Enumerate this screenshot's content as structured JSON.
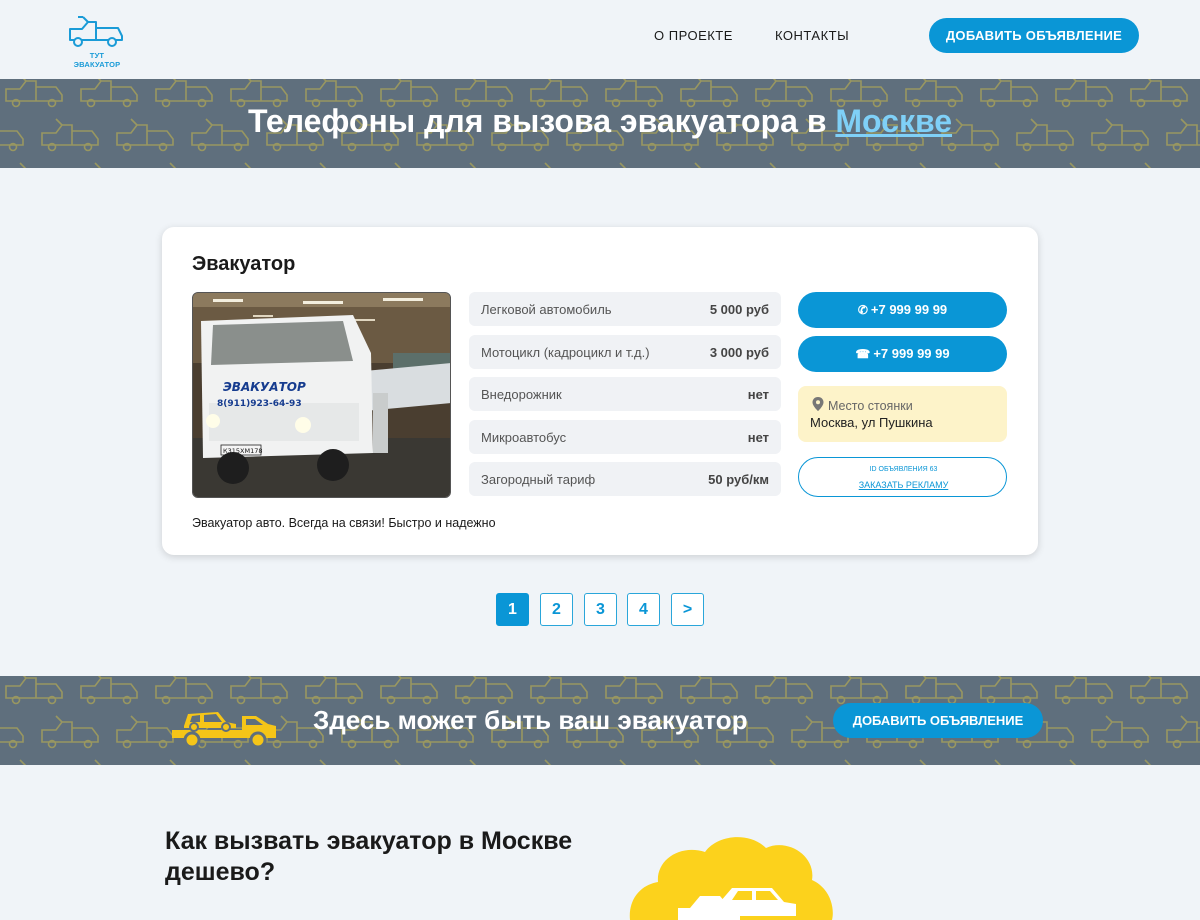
{
  "header": {
    "logo_text": "ТУТ ЭВАКУАТОР",
    "nav": [
      "О ПРОЕКТЕ",
      "КОНТАКТЫ"
    ],
    "add_button": "ДОБАВИТЬ ОБЪЯВЛЕНИЕ"
  },
  "hero": {
    "title_prefix": "Телефоны для вызова эвакуатора в ",
    "city": "Москве"
  },
  "listing": {
    "title": "Эвакуатор",
    "photo_text": "ЭВАКУАТОР",
    "photo_phone": "8(911)923-64-93",
    "photo_plate": "К315ХМ178",
    "prices": [
      {
        "label": "Легковой автомобиль",
        "value": "5 000 руб"
      },
      {
        "label": "Мотоцикл (кадроцикл и т.д.)",
        "value": "3 000 руб"
      },
      {
        "label": "Внедорожник",
        "value": "нет"
      },
      {
        "label": "Микроавтобус",
        "value": "нет"
      },
      {
        "label": "Загородный тариф",
        "value": "50 руб/км"
      }
    ],
    "phones": [
      "+7 999 99 99",
      "+7 999 99 99"
    ],
    "parking_label": "Место стоянки",
    "parking_address": "Москва, ул Пушкина",
    "ad_id": "ID ОБЪЯВЛЕНИЯ 63",
    "ad_link": "ЗАКАЗАТЬ РЕКЛАМУ",
    "description": "Эвакуатор авто. Всегда на связи! Быстро и надежно"
  },
  "pagination": {
    "pages": [
      "1",
      "2",
      "3",
      "4",
      ">"
    ],
    "active": "1"
  },
  "promo": {
    "text": "Здесь может быть ваш эвакуатор",
    "button": "ДОБАВИТЬ ОБЪЯВЛЕНИЕ"
  },
  "how": {
    "title": "Как вызвать эвакуатор в Москве дешево?"
  },
  "colors": {
    "accent": "#0a96d6",
    "band": "#5f6f7d",
    "pattern": "#c9b94a",
    "yellow": "#f5c518",
    "parking_bg": "#fdf3c9"
  },
  "icons": [
    "tow-truck-logo-icon",
    "phone-icon",
    "telephone-icon",
    "map-pin-icon",
    "yellow-tow-truck-icon",
    "cloud-truck-icon"
  ]
}
